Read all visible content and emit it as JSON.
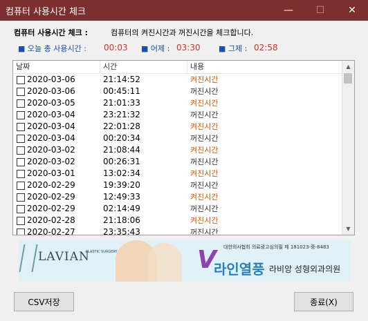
{
  "window": {
    "title": "컴퓨터 사용시간 체크",
    "min": "—",
    "max": "☐",
    "close": "✕"
  },
  "header": {
    "label": "컴퓨터 사용시간 체크 :",
    "desc": "컴퓨터의 켜진시간과 꺼진시간을 체크합니다."
  },
  "stats": {
    "today": {
      "bullet": "■",
      "label": "오늘 총 사용시간 :",
      "value": "00:03"
    },
    "yesterday": {
      "bullet": "■",
      "label": "어제 :",
      "value": "03:30"
    },
    "daybefore": {
      "bullet": "■",
      "label": "그제 :",
      "value": "02:58"
    }
  },
  "table": {
    "columns": [
      "날짜",
      "시간",
      "내용"
    ],
    "rows": [
      {
        "date": "2020-03-06",
        "time": "21:14:52",
        "content": "켜진시간",
        "state": "on"
      },
      {
        "date": "2020-03-06",
        "time": "00:45:11",
        "content": "꺼진시간",
        "state": "off"
      },
      {
        "date": "2020-03-05",
        "time": "21:01:33",
        "content": "켜진시간",
        "state": "on"
      },
      {
        "date": "2020-03-04",
        "time": "23:21:32",
        "content": "꺼진시간",
        "state": "off"
      },
      {
        "date": "2020-03-04",
        "time": "22:01:28",
        "content": "켜진시간",
        "state": "on"
      },
      {
        "date": "2020-03-04",
        "time": "00:20:34",
        "content": "꺼진시간",
        "state": "off"
      },
      {
        "date": "2020-03-02",
        "time": "21:08:44",
        "content": "켜진시간",
        "state": "on"
      },
      {
        "date": "2020-03-02",
        "time": "00:26:31",
        "content": "꺼진시간",
        "state": "off"
      },
      {
        "date": "2020-03-01",
        "time": "13:02:34",
        "content": "켜진시간",
        "state": "on"
      },
      {
        "date": "2020-02-29",
        "time": "19:39:20",
        "content": "꺼진시간",
        "state": "off"
      },
      {
        "date": "2020-02-29",
        "time": "12:49:33",
        "content": "켜진시간",
        "state": "on"
      },
      {
        "date": "2020-02-29",
        "time": "02:14:49",
        "content": "꺼진시간",
        "state": "off"
      },
      {
        "date": "2020-02-28",
        "time": "21:18:06",
        "content": "켜진시간",
        "state": "on"
      },
      {
        "date": "2020-02-27",
        "time": "23:35:43",
        "content": "꺼진시간",
        "state": "off"
      }
    ]
  },
  "banner": {
    "brand": "LAVIAN",
    "brand_sub": "PLASTIC SURGERY",
    "notice": "대한의사협회 의료광고심의필 제 181023-중-8483",
    "v": "V",
    "line": "라인열풍",
    "clinic": "라비앙 성형외과의원"
  },
  "buttons": {
    "csv": "CSV저장",
    "exit": "종료(X)"
  }
}
